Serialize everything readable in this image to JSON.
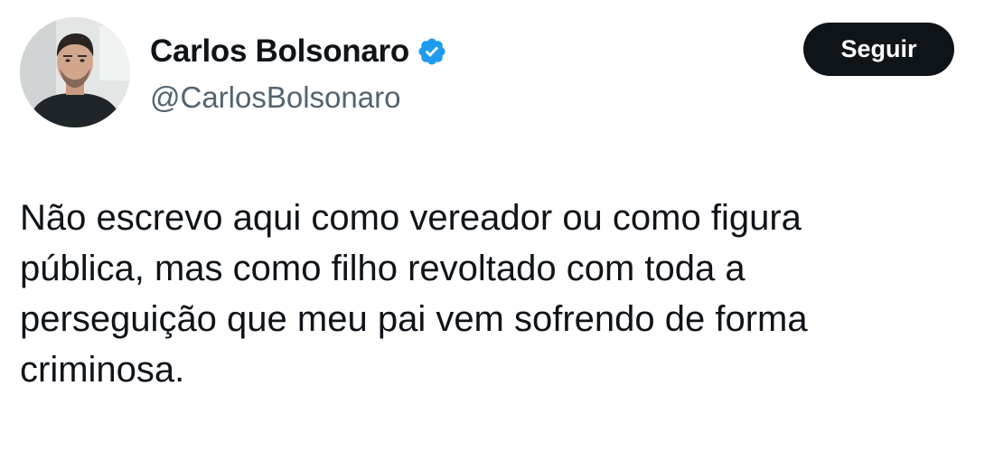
{
  "author": {
    "display_name": "Carlos Bolsonaro",
    "handle": "@CarlosBolsonaro",
    "verified": true,
    "verified_badge_color": "#1d9bf0",
    "avatar_icon": "profile-photo"
  },
  "actions": {
    "follow_label": "Seguir"
  },
  "tweet": {
    "text_lines": [
      "Não escrevo aqui como vereador ou como figura",
      "pública, mas como filho revoltado com toda a",
      "perseguição que meu pai vem sofrendo de forma",
      "criminosa."
    ]
  },
  "colors": {
    "text_primary": "#0f1419",
    "text_secondary": "#536471",
    "button_bg": "#0f1419",
    "button_text": "#ffffff"
  }
}
